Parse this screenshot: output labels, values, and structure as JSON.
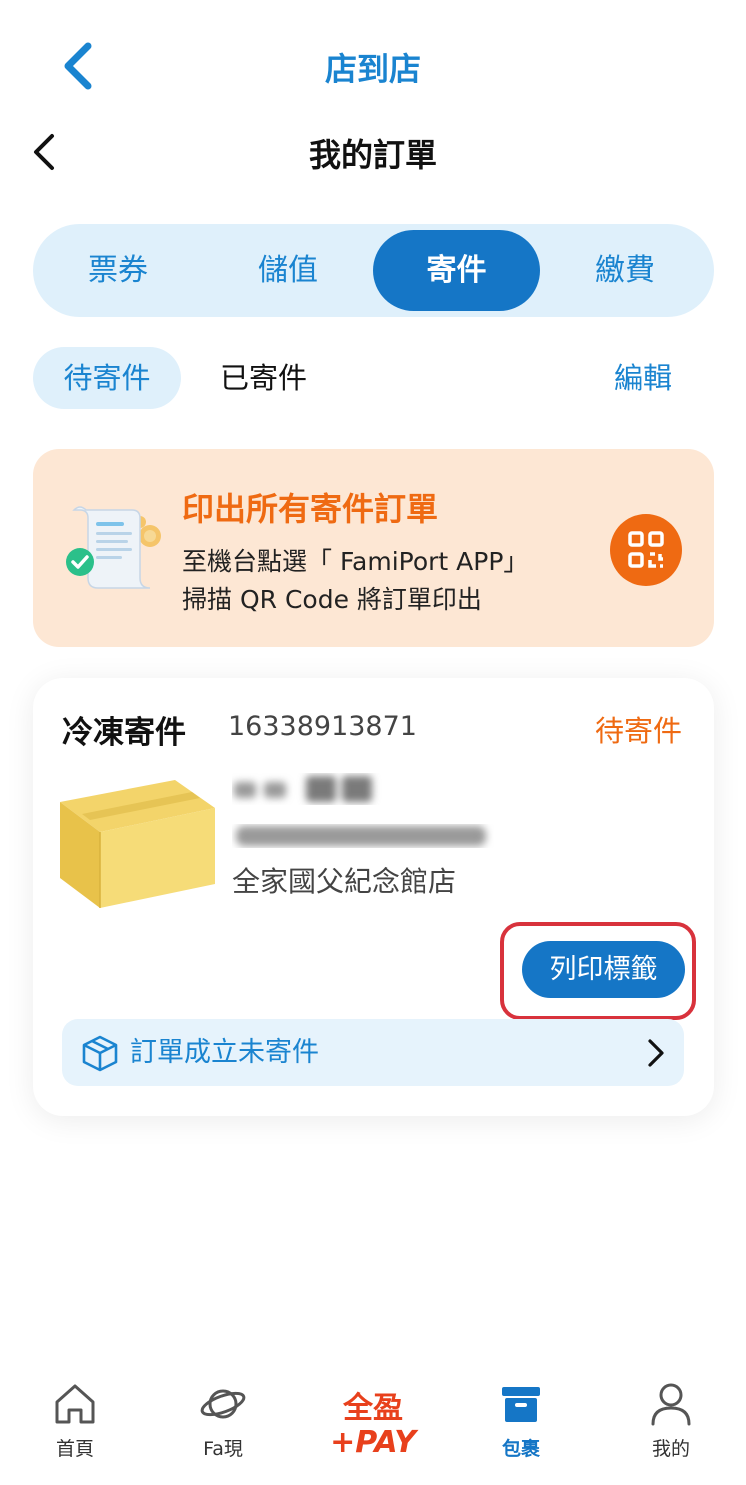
{
  "header": {
    "app_title": "店到店",
    "page_title": "我的訂單"
  },
  "category_tabs": [
    {
      "label": "票券",
      "active": false
    },
    {
      "label": "儲值",
      "active": false
    },
    {
      "label": "寄件",
      "active": true
    },
    {
      "label": "繳費",
      "active": false
    }
  ],
  "status_tabs": {
    "pending": "待寄件",
    "sent": "已寄件",
    "edit": "編輯"
  },
  "print_banner": {
    "title": "印出所有寄件訂單",
    "line1": "至機台點選「 FamiPort APP」",
    "line2": "掃描 QR Code 將訂單印出",
    "qr_icon": "qr-code-icon"
  },
  "order": {
    "type": "冷凍寄件",
    "number": "16338913871",
    "status": "待寄件",
    "store": "全家國父紀念館店",
    "print_label": "列印標籤",
    "progress_text": "訂單成立未寄件"
  },
  "bottom_nav": [
    {
      "label": "首頁",
      "icon": "home-icon",
      "active": false
    },
    {
      "label": "Fa現",
      "icon": "planet-icon",
      "active": false
    },
    {
      "label": "全盈+PAY",
      "icon": "pay-logo",
      "active": false
    },
    {
      "label": "包裹",
      "icon": "package-icon",
      "active": true
    },
    {
      "label": "我的",
      "icon": "user-icon",
      "active": false
    }
  ],
  "colors": {
    "primary_blue": "#1576c6",
    "accent_orange": "#ef6a12",
    "highlight_red": "#d8323c"
  }
}
